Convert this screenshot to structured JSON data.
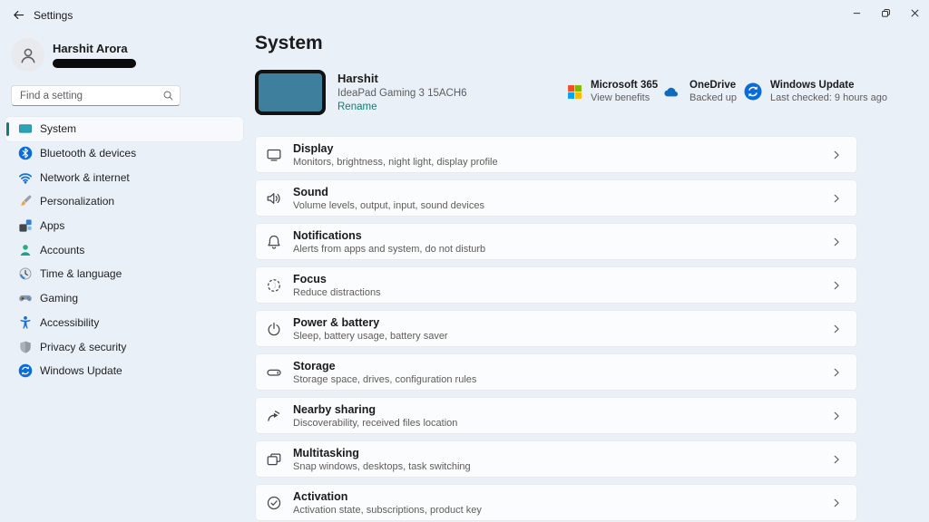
{
  "titlebar": {
    "app_title": "Settings"
  },
  "sidebar": {
    "profile": {
      "name": "Harshit Arora",
      "email_redacted": true
    },
    "search": {
      "placeholder": "Find a setting"
    },
    "items": [
      {
        "label": "System",
        "icon": "system-icon",
        "selected": true
      },
      {
        "label": "Bluetooth & devices",
        "icon": "bluetooth-icon",
        "selected": false
      },
      {
        "label": "Network & internet",
        "icon": "network-icon",
        "selected": false
      },
      {
        "label": "Personalization",
        "icon": "personalization-icon",
        "selected": false
      },
      {
        "label": "Apps",
        "icon": "apps-icon",
        "selected": false
      },
      {
        "label": "Accounts",
        "icon": "accounts-icon",
        "selected": false
      },
      {
        "label": "Time & language",
        "icon": "time-language-icon",
        "selected": false
      },
      {
        "label": "Gaming",
        "icon": "gaming-icon",
        "selected": false
      },
      {
        "label": "Accessibility",
        "icon": "accessibility-icon",
        "selected": false
      },
      {
        "label": "Privacy & security",
        "icon": "privacy-security-icon",
        "selected": false
      },
      {
        "label": "Windows Update",
        "icon": "windows-update-icon",
        "selected": false
      }
    ]
  },
  "main": {
    "title": "System",
    "device": {
      "name": "Harshit",
      "model": "IdeaPad Gaming 3 15ACH6",
      "rename_label": "Rename"
    },
    "status_items": [
      {
        "label": "Microsoft 365",
        "sub": "View benefits",
        "icon": "microsoft-365-icon"
      },
      {
        "label": "OneDrive",
        "sub": "Backed up",
        "icon": "onedrive-icon"
      },
      {
        "label": "Windows Update",
        "sub": "Last checked: 9 hours ago",
        "icon": "windows-update-icon"
      }
    ],
    "rows": [
      {
        "title": "Display",
        "subtitle": "Monitors, brightness, night light, display profile",
        "icon": "display-icon"
      },
      {
        "title": "Sound",
        "subtitle": "Volume levels, output, input, sound devices",
        "icon": "sound-icon"
      },
      {
        "title": "Notifications",
        "subtitle": "Alerts from apps and system, do not disturb",
        "icon": "notifications-icon"
      },
      {
        "title": "Focus",
        "subtitle": "Reduce distractions",
        "icon": "focus-icon"
      },
      {
        "title": "Power & battery",
        "subtitle": "Sleep, battery usage, battery saver",
        "icon": "power-icon"
      },
      {
        "title": "Storage",
        "subtitle": "Storage space, drives, configuration rules",
        "icon": "storage-icon"
      },
      {
        "title": "Nearby sharing",
        "subtitle": "Discoverability, received files location",
        "icon": "nearby-sharing-icon"
      },
      {
        "title": "Multitasking",
        "subtitle": "Snap windows, desktops, task switching",
        "icon": "multitasking-icon"
      },
      {
        "title": "Activation",
        "subtitle": "Activation state, subscriptions, product key",
        "icon": "activation-icon"
      }
    ]
  },
  "colors": {
    "background": "#eaf0f8",
    "card": "#fbfcfd",
    "accent_teal": "#117d74",
    "text_primary": "#1b1b1b",
    "text_secondary": "#5d5d5d",
    "icon_blue": "#0a6cd6",
    "device_thumb_fill": "#3e7f9d",
    "ms_red": "#f25022",
    "ms_green": "#7fba00",
    "ms_blue": "#00a4ef",
    "ms_yellow": "#ffb900",
    "onedrive_blue": "#0f6cbd"
  }
}
